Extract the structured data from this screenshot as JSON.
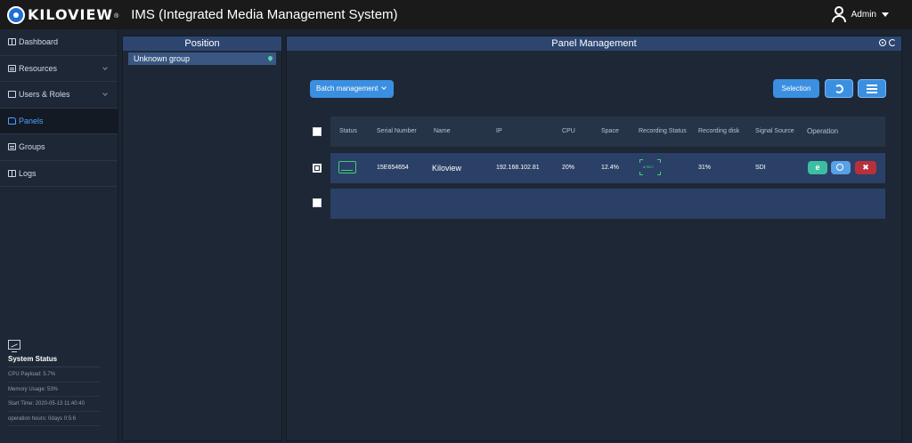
{
  "header": {
    "logo_text": "KILOVIEW",
    "logo_mark": "®",
    "app_title": "IMS (Integrated Media Management System)",
    "user_name": "Admin"
  },
  "sidebar": {
    "items": [
      {
        "label": "Dashboard",
        "icon": "grid-icon"
      },
      {
        "label": "Resources",
        "icon": "list-icon"
      },
      {
        "label": "Users & Roles",
        "icon": "users-icon"
      },
      {
        "label": "Panels",
        "icon": "folder-icon"
      },
      {
        "label": "Groups",
        "icon": "list-icon"
      },
      {
        "label": "Logs",
        "icon": "grid-icon"
      }
    ],
    "system_status": {
      "title": "System Status",
      "cpu": "CPU Payload: 5.7%",
      "memory": "Memory Usage: 53%",
      "start_time": "Start Time: 2020-05-13 11:40:40",
      "hours": "operation hours: 0days 0:5:6"
    }
  },
  "position": {
    "title": "Position",
    "groups": [
      {
        "label": "Unknown group"
      }
    ]
  },
  "panel_management": {
    "title": "Panel Management",
    "batch_label": "Batch management",
    "selection_label": "Selection",
    "columns": {
      "status": "Status",
      "serial": "Serial Number",
      "name": "Name",
      "ip": "IP",
      "cpu": "CPU",
      "space": "Space",
      "recording_status": "Recording Status",
      "recording_disk": "Recording disk",
      "signal_source": "Signal Source",
      "operation": "Operation"
    },
    "rows": [
      {
        "serial": "15E654654",
        "name": "Kiloview",
        "ip": "192.168.102.81",
        "cpu": "20%",
        "space": "12.4%",
        "recording_label": "● REC",
        "recording_disk": "31%",
        "signal_source": "SDI",
        "edit_label": "e",
        "delete_label": "✖"
      }
    ]
  },
  "colors": {
    "accent": "#3b8fe0",
    "status_ok": "#3fcf7a",
    "danger": "#b8313a",
    "active_nav": "#4ea0ff"
  }
}
